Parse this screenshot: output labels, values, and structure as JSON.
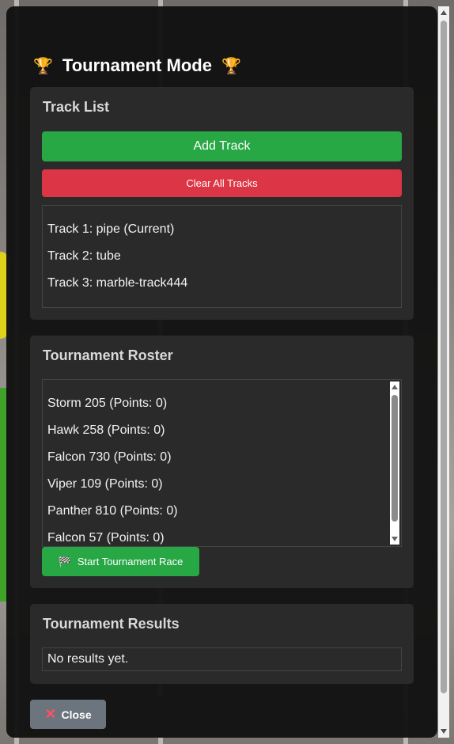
{
  "modal": {
    "title": "Tournament Mode",
    "title_icon": "trophy-icon"
  },
  "track_list": {
    "heading": "Track List",
    "add_label": "Add Track",
    "clear_label": "Clear All Tracks",
    "tracks": [
      "Track 1: pipe (Current)",
      "Track 2: tube",
      "Track 3: marble-track444"
    ]
  },
  "roster": {
    "heading": "Tournament Roster",
    "entries": [
      "Storm 205 (Points: 0)",
      "Hawk 258 (Points: 0)",
      "Falcon 730 (Points: 0)",
      "Viper 109 (Points: 0)",
      "Panther 810 (Points: 0)",
      "Falcon 57 (Points: 0)"
    ],
    "start_label": "Start Tournament Race",
    "start_icon": "checkered-flag-icon"
  },
  "results": {
    "heading": "Tournament Results",
    "empty_text": "No results yet."
  },
  "footer": {
    "close_label": "Close",
    "close_icon": "close-icon"
  },
  "colors": {
    "primary_green": "#28a745",
    "danger_red": "#dc3545",
    "secondary_gray": "#6c757d",
    "panel_bg": "#2a2a2a"
  }
}
